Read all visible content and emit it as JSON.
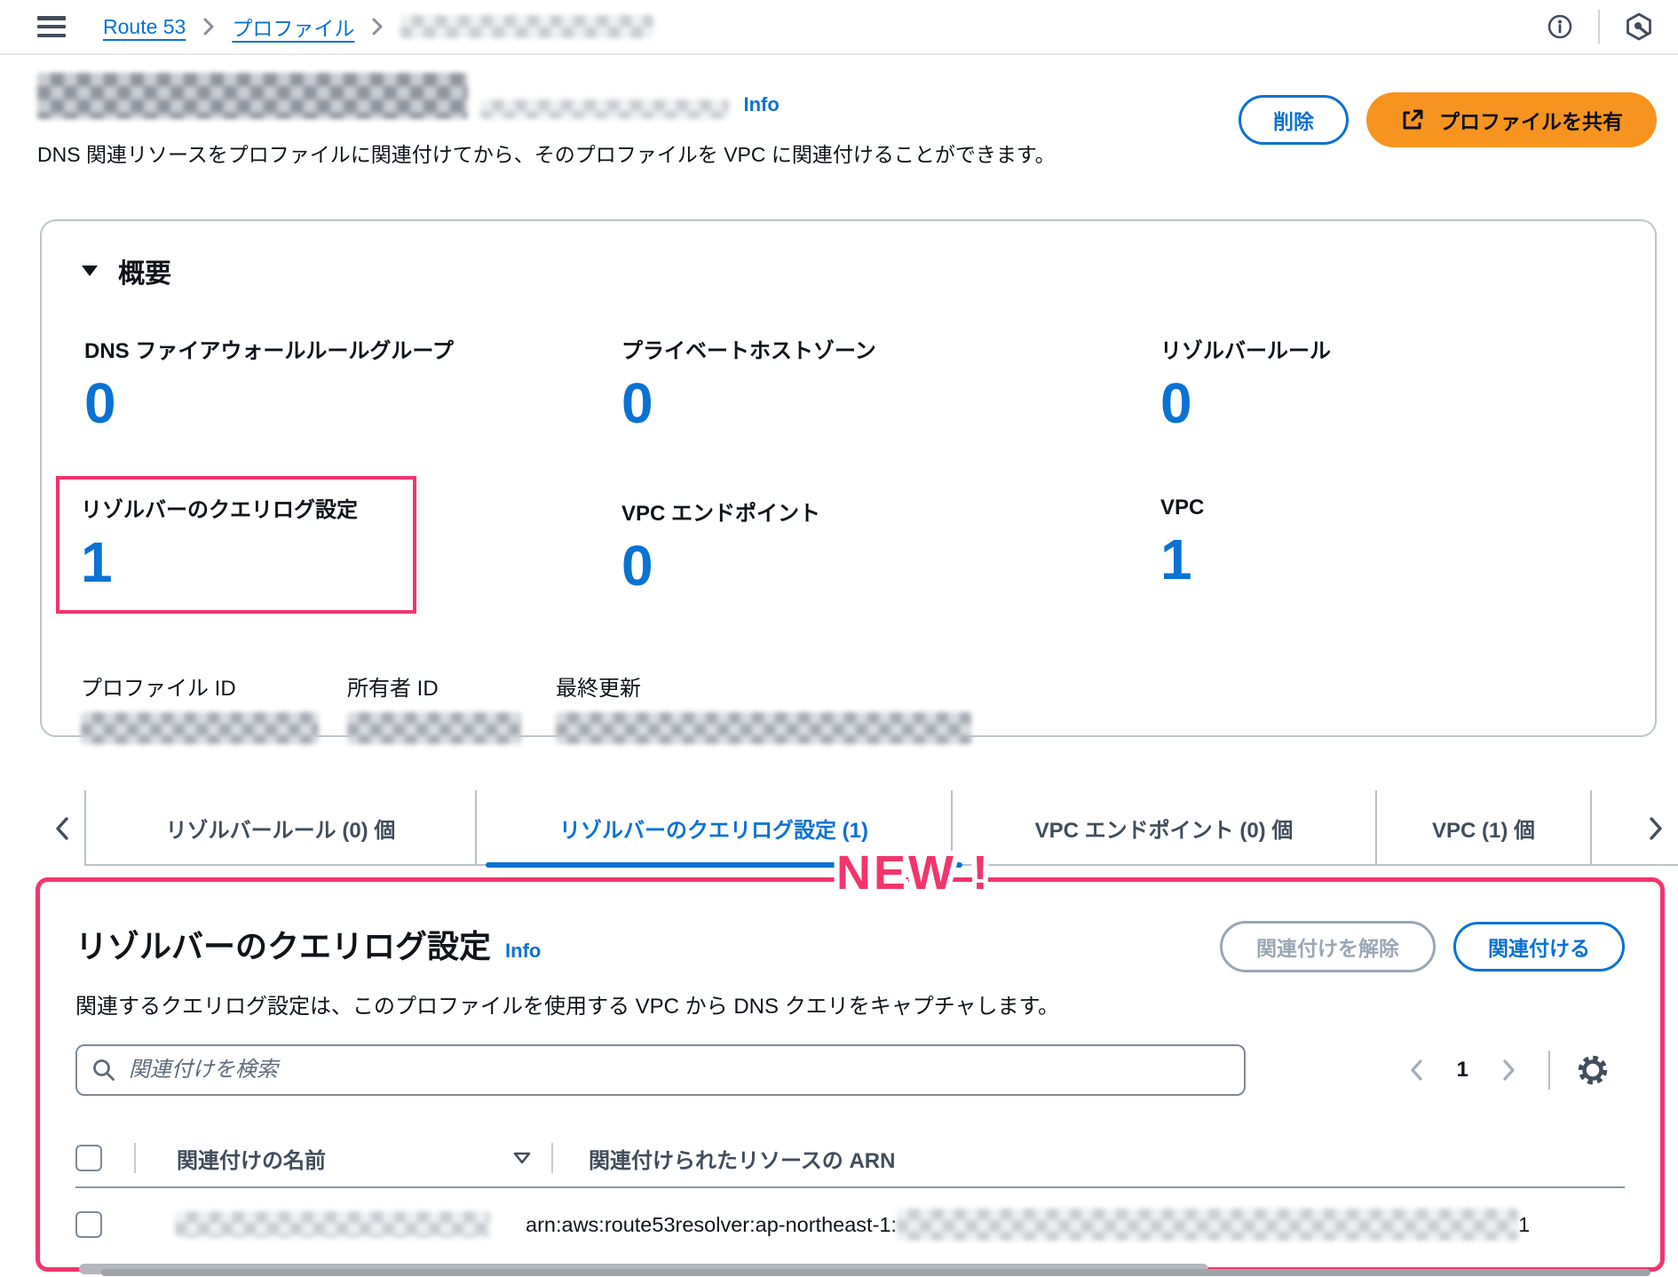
{
  "colors": {
    "accent_blue": "#0972d3",
    "highlight_pink": "#f2356d",
    "primary_orange": "#f7941f"
  },
  "topbar": {
    "breadcrumb": [
      "Route 53",
      "プロファイル"
    ]
  },
  "header": {
    "info_label": "Info",
    "description": "DNS 関連リソースをプロファイルに関連付けてから、そのプロファイルを VPC に関連付けることができます。",
    "delete_button": "削除",
    "share_button": "プロファイルを共有"
  },
  "overview": {
    "title": "概要",
    "stats": [
      {
        "label": "DNS ファイアウォールルールグループ",
        "value": "0"
      },
      {
        "label": "プライベートホストゾーン",
        "value": "0"
      },
      {
        "label": "リゾルバールール",
        "value": "0"
      },
      {
        "label": "リゾルバーのクエリログ設定",
        "value": "1"
      },
      {
        "label": "VPC エンドポイント",
        "value": "0"
      },
      {
        "label": "VPC",
        "value": "1"
      }
    ],
    "meta": [
      {
        "label": "プロファイル ID"
      },
      {
        "label": "所有者 ID"
      },
      {
        "label": "最終更新"
      }
    ]
  },
  "tabs": [
    {
      "label": "リゾルバールール (0) 個"
    },
    {
      "label": "リゾルバーのクエリログ設定 (1)"
    },
    {
      "label": "VPC エンドポイント (0) 個"
    },
    {
      "label": "VPC (1) 個"
    }
  ],
  "annotation": {
    "new_badge": "NEW !"
  },
  "panel": {
    "title": "リゾルバーのクエリログ設定",
    "info_label": "Info",
    "description": "関連するクエリログ設定は、このプロファイルを使用する VPC から DNS クエリをキャプチャします。",
    "detach_button": "関連付けを解除",
    "attach_button": "関連付ける",
    "search_placeholder": "関連付けを検索",
    "pagination": {
      "page": "1"
    },
    "table": {
      "columns": [
        "関連付けの名前",
        "関連付けられたリソースの ARN"
      ],
      "row": {
        "arn_prefix": "arn:aws:route53resolver:ap-northeast-1:",
        "arn_suffix": "1"
      }
    }
  }
}
